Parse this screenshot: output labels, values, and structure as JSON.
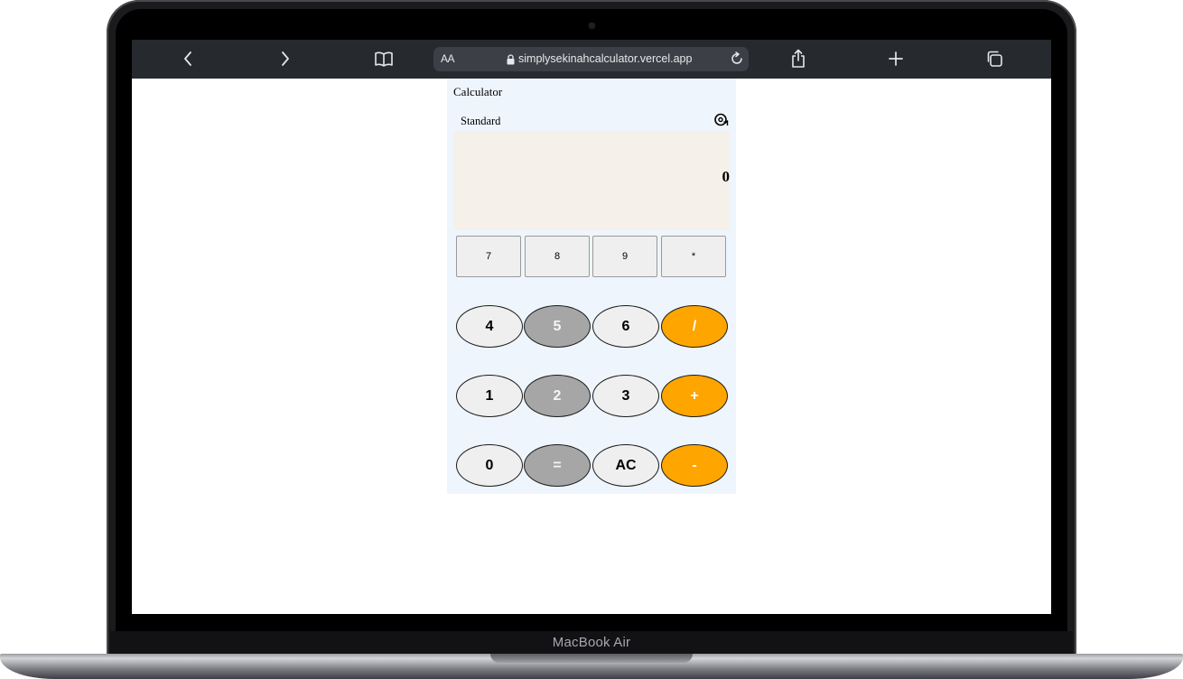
{
  "device": {
    "model_label": "MacBook Air"
  },
  "browser": {
    "text_size_label": "AA",
    "url": "simplysekinahcalculator.vercel.app",
    "icons": {
      "back": "chevron-left-icon",
      "forward": "chevron-right-icon",
      "bookmarks": "book-icon",
      "lock": "lock-icon",
      "reload": "reload-icon",
      "share": "share-icon",
      "new_tab": "plus-icon",
      "tabs": "tabs-icon"
    },
    "toolbar_color": "#26292e"
  },
  "calculator": {
    "title": "Calculator",
    "mode": "Standard",
    "history_icon": "history-icon",
    "display_value": "0",
    "top_row": [
      "7",
      "8",
      "9",
      "*"
    ],
    "rows": [
      [
        "4",
        "5",
        "6",
        "/"
      ],
      [
        "1",
        "2",
        "3",
        "+"
      ],
      [
        "0",
        "=",
        "AC",
        "-"
      ]
    ],
    "colors": {
      "background": "#eef5fc",
      "display": "#f5f1ea",
      "light_key": "#efefef",
      "gray_key": "#a6a6a6",
      "operator_key": "#ffa500"
    }
  }
}
